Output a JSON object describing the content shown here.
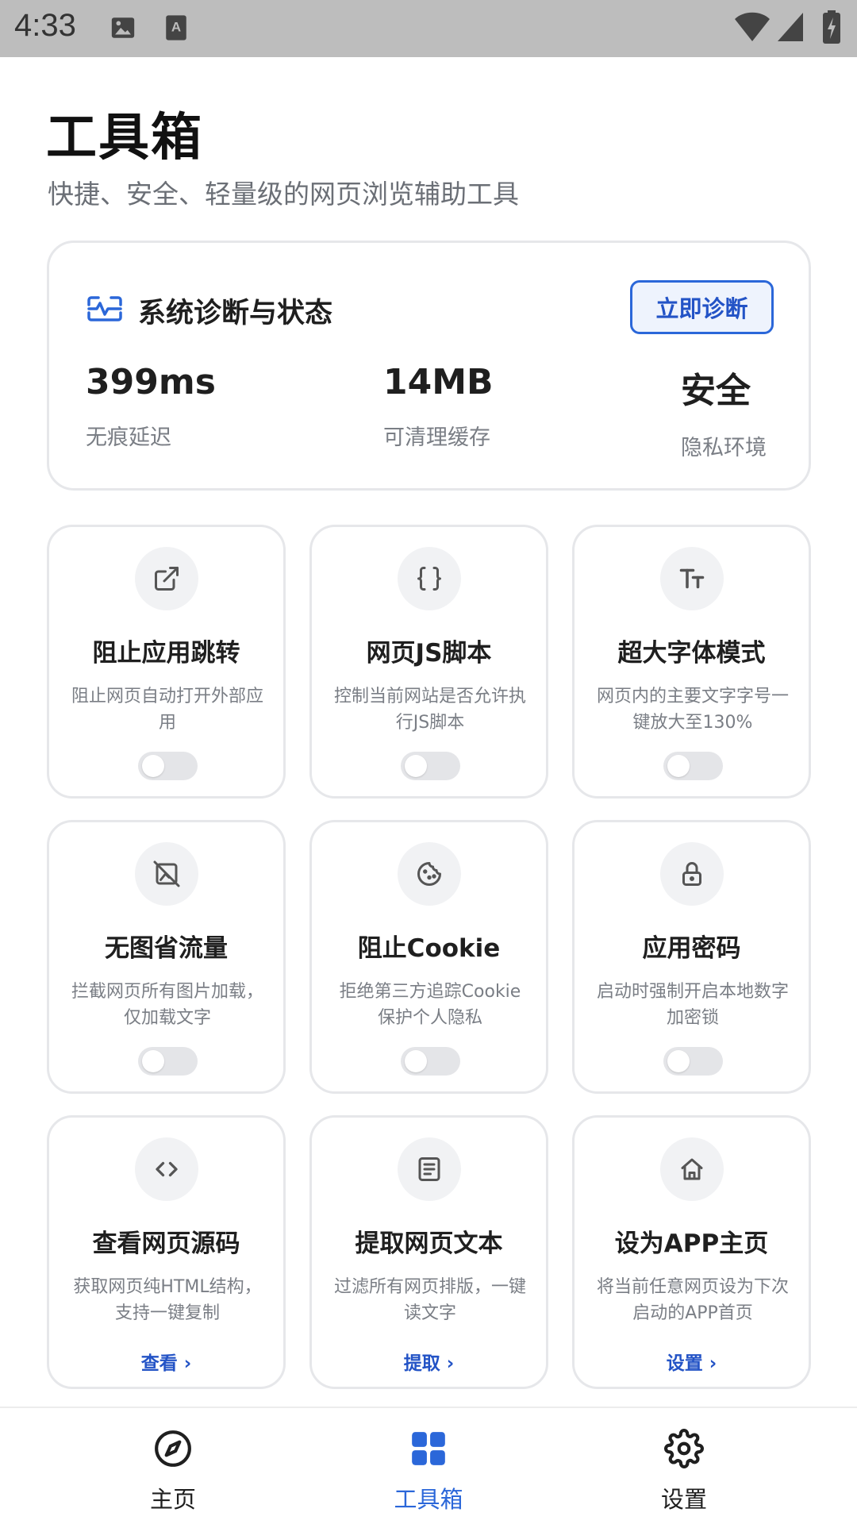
{
  "status_bar": {
    "time": "4:33"
  },
  "header": {
    "title": "工具箱",
    "subtitle": "快捷、安全、轻量级的网页浏览辅助工具"
  },
  "diagnosis": {
    "title": "系统诊断与状态",
    "button_label": "立即诊断",
    "stats": [
      {
        "value": "399ms",
        "label": "无痕延迟"
      },
      {
        "value": "14MB",
        "label": "可清理缓存"
      },
      {
        "value": "安全",
        "label": "隐私环境"
      }
    ]
  },
  "tools": [
    {
      "title": "阻止应用跳转",
      "desc": "阻止网页自动打开外部应用",
      "icon": "external-link-icon",
      "toggle_on": false
    },
    {
      "title": "网页JS脚本",
      "desc": "控制当前网站是否允许执行JS脚本",
      "icon": "braces-icon",
      "toggle_on": false
    },
    {
      "title": "超大字体模式",
      "desc": "网页内的主要文字字号一键放大至130%",
      "icon": "text-size-icon",
      "toggle_on": false
    },
    {
      "title": "无图省流量",
      "desc": "拦截网页所有图片加载，仅加载文字",
      "icon": "image-off-icon",
      "toggle_on": false
    },
    {
      "title": "阻止Cookie",
      "desc": "拒绝第三方追踪Cookie保护个人隐私",
      "icon": "cookie-icon",
      "toggle_on": false
    },
    {
      "title": "应用密码",
      "desc": "启动时强制开启本地数字加密锁",
      "icon": "lock-icon",
      "toggle_on": false
    },
    {
      "title": "查看网页源码",
      "desc": "获取网页纯HTML结构，支持一键复制",
      "icon": "code-icon",
      "action": "查看 ›"
    },
    {
      "title": "提取网页文本",
      "desc": "过滤所有网页排版，一键读文字",
      "icon": "document-icon",
      "action": "提取 ›"
    },
    {
      "title": "设为APP主页",
      "desc": "将当前任意网页设为下次启动的APP首页",
      "icon": "home-icon",
      "action": "设置 ›"
    }
  ],
  "bottom_nav": [
    {
      "label": "主页",
      "icon": "compass-icon",
      "active": false
    },
    {
      "label": "工具箱",
      "icon": "grid-icon",
      "active": true
    },
    {
      "label": "设置",
      "icon": "gear-icon",
      "active": false
    }
  ],
  "colors": {
    "accent": "#2b67d9",
    "card_border": "#e6e7ea",
    "muted_text": "#7a7e85",
    "status_bar": "#bdbdbd"
  }
}
